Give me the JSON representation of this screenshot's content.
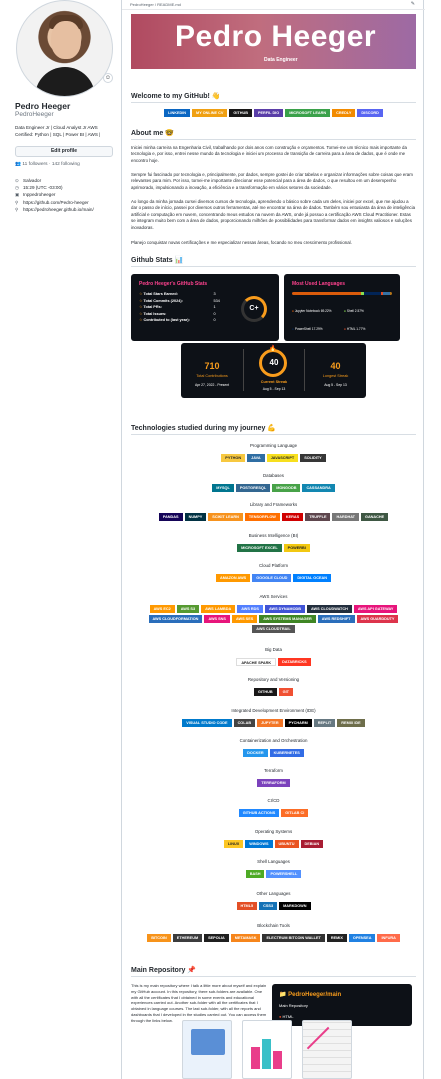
{
  "profile": {
    "name": "Pedro Heeger",
    "username": "PedroHeeger",
    "bio": "Data Engineer Jr | Cloud Analyst Jr AWS Certified: Python | SQL | Power BI | AWS |",
    "edit_label": "Edit profile",
    "followers": "11 followers · 142 following",
    "location": "Salvador",
    "time": "15:29 (UTC -03:00)",
    "email": "Inppedroheeger",
    "links": [
      "https://github.com/Pedro-heeger",
      "https://pedroheeger.github.io/main/"
    ]
  },
  "file": {
    "path": "PedroHeeger / README.md"
  },
  "banner": {
    "title": "Pedro Heeger",
    "subtitle": "Data Engineer"
  },
  "welcome": {
    "title": "Welcome to my GitHub! 👋"
  },
  "social": [
    {
      "label": "LINKEDIN",
      "color": "#0a66c2"
    },
    {
      "label": "MY ONLINE CV",
      "color": "#f0a012"
    },
    {
      "label": "GITHUB",
      "color": "#181717"
    },
    {
      "label": "PERFIL DIO",
      "color": "#5a3ea8"
    },
    {
      "label": "MICROSOFT LEARN",
      "color": "#3aa14a"
    },
    {
      "label": "CREDLY",
      "color": "#f28b00"
    },
    {
      "label": "DISCORD",
      "color": "#5865f2"
    }
  ],
  "about": {
    "title": "About me 🤓",
    "paragraphs": [
      "Iniciei minha carreira na Engenharia Civil, trabalhando por dois anos com construção e orçamentos. Tornei-me um técnico mais importante da tecnologia e, por isso, entrei nesse mundo da tecnologia e iniciei um processo de transição de carreira para a área de dados, que é onde me encontro hoje.",
      "Sempre fui fascinado por tecnologia e, principalmente, por dados, sempre gostei de criar tabelas e organizar informações sobre coisas que eram relevantes para mim. Por isso, tornei-me importante direcionar esse potencial para a área de dados, o que resultou em um desempenho aprimorado, impulsionando a inovação, a eficiência e a transformação em vários setores da sociedade.",
      "Ao longo da minha jornada cursei diversos cursos de tecnologia, aprendendo o básico sobre cada um deles, iniciei por excel, que me ajudou a dar o passo de início, passei por diversos outros ferramentas, até me encontrar na área de dados. Também sou entusiasta da área de inteligência artificial e computação em nuvem, concentrando meus estudos na nuvem da AWS, onde já possuo a certificação AWS Cloud Practitioner. Estas se integram muito bem com a área de dados, proporcionando milhões de possibilidades para transformar dados em insights valiosos e soluções inovadoras.",
      "Planejo conquistar novas certificações e me especializar nessas áreas, focando no meu crescimento profissional."
    ]
  },
  "stats": {
    "title": "Github Stats 📊",
    "card_title": "Pedro Heeger's GitHub Stats",
    "rows": [
      {
        "label": "Total Stars Earned:",
        "value": "3"
      },
      {
        "label": "Total Commits (2024):",
        "value": "534"
      },
      {
        "label": "Total PRs:",
        "value": "1"
      },
      {
        "label": "Total Issues:",
        "value": "0"
      },
      {
        "label": "Contributed to (last year):",
        "value": "0"
      }
    ],
    "grade": "C+",
    "languages_title": "Most Used Languages",
    "languages": [
      {
        "name": "Jupyter Notebook",
        "pct": "69.22%",
        "color": "#DA5B0B"
      },
      {
        "name": "Shell",
        "pct": "2.57%",
        "color": "#89e051"
      },
      {
        "name": "PowerShell",
        "pct": "17.29%",
        "color": "#012456"
      },
      {
        "name": "HTML",
        "pct": "1.77%",
        "color": "#e34c26"
      },
      {
        "name": "Python",
        "pct": "7.29%",
        "color": "#3572A5"
      },
      {
        "name": "JavaScript",
        "pct": "0.09%",
        "color": "#f1e05a"
      },
      {
        "name": "Java",
        "pct": "1.63%",
        "color": "#b07219"
      },
      {
        "name": "Solidity",
        "pct": "0.03%",
        "color": "#AA6746"
      }
    ],
    "streak": {
      "total": "710",
      "total_label": "Total Contributions",
      "total_range": "Apr 27, 2022 - Present",
      "current": "40",
      "current_label": "Current Streak",
      "current_range": "Aug 5 - Sep 13",
      "longest": "40",
      "longest_label": "Longest Streak",
      "longest_range": "Aug 5 - Sep 13"
    }
  },
  "tech": {
    "title": "Technologies studied during my journey 💪",
    "groups": [
      {
        "name": "Programming Language",
        "items": [
          {
            "label": "PYTHON",
            "color": "#f7c840",
            "dark": true
          },
          {
            "label": "JAVA",
            "color": "#2f6ea3"
          },
          {
            "label": "JAVASCRIPT",
            "color": "#f7df1e",
            "dark": true
          },
          {
            "label": "SOLIDITY",
            "color": "#363636"
          }
        ]
      },
      {
        "name": "Databases",
        "items": [
          {
            "label": "MYSQL",
            "color": "#00758f"
          },
          {
            "label": "POSTGRESQL",
            "color": "#336791"
          },
          {
            "label": "MONGODB",
            "color": "#47a248"
          },
          {
            "label": "CASSANDRA",
            "color": "#1287b1"
          }
        ]
      },
      {
        "name": "Library and Frameworks",
        "items": [
          {
            "label": "PANDAS",
            "color": "#150458"
          },
          {
            "label": "NUMPY",
            "color": "#013243"
          },
          {
            "label": "SCIKIT LEARN",
            "color": "#f7931e"
          },
          {
            "label": "TENSORFLOW",
            "color": "#ff6f00"
          },
          {
            "label": "KERAS",
            "color": "#d00000"
          },
          {
            "label": "TRUFFLE",
            "color": "#5e464d"
          },
          {
            "label": "HARDHAT",
            "color": "#777777"
          },
          {
            "label": "GANACHE",
            "color": "#3e5743"
          }
        ]
      },
      {
        "name": "Business Intelligence (BI)",
        "items": [
          {
            "label": "MICROSOFT EXCEL",
            "color": "#217346"
          },
          {
            "label": "POWERBI",
            "color": "#f2c811",
            "dark": true
          }
        ]
      },
      {
        "name": "Cloud Platform",
        "items": [
          {
            "label": "AMAZON AWS",
            "color": "#ff9900"
          },
          {
            "label": "GOOGLE CLOUD",
            "color": "#4285f4"
          },
          {
            "label": "DIGITAL OCEAN",
            "color": "#0080ff"
          }
        ]
      },
      {
        "name": "AWS Services",
        "items": [
          {
            "label": "AWS EC2",
            "color": "#ff9900"
          },
          {
            "label": "AWS S3",
            "color": "#569a31"
          },
          {
            "label": "AWS LAMBDA",
            "color": "#ff9900"
          },
          {
            "label": "AWS RDS",
            "color": "#527fff"
          },
          {
            "label": "AWS DYNAMODB",
            "color": "#4053d6"
          },
          {
            "label": "AWS CLOUDWATCH",
            "color": "#232f3e"
          },
          {
            "label": "AWS API GATEWAY",
            "color": "#e7157b"
          },
          {
            "label": "AWS CLOUDFORMATION",
            "color": "#2a6ebb"
          },
          {
            "label": "AWS SNS",
            "color": "#e7157b"
          },
          {
            "label": "AWS SES",
            "color": "#ff9900"
          },
          {
            "label": "AWS SYSTEMS MANAGER",
            "color": "#3f8624"
          },
          {
            "label": "AWS REDSHIFT",
            "color": "#2a6ebb"
          },
          {
            "label": "AWS GUARDDUTY",
            "color": "#dd344c"
          },
          {
            "label": "AWS CLOUDTRAIL",
            "color": "#555555"
          }
        ]
      },
      {
        "name": "Big Data",
        "items": [
          {
            "label": "APACHE SPARK",
            "color": "#ffffff",
            "dark": true
          },
          {
            "label": "DATABRICKS",
            "color": "#ff3621"
          }
        ]
      },
      {
        "name": "Repository and Versioning",
        "items": [
          {
            "label": "GITHUB",
            "color": "#181717"
          },
          {
            "label": "GIT",
            "color": "#f05032"
          }
        ]
      },
      {
        "name": "Integrated Development Environment (IDE)",
        "items": [
          {
            "label": "VISUAL STUDIO CODE",
            "color": "#007acc"
          },
          {
            "label": "COLAB",
            "color": "#444444"
          },
          {
            "label": "JUPYTER",
            "color": "#f37626"
          },
          {
            "label": "PYCHARM",
            "color": "#000000"
          },
          {
            "label": "REPLIT",
            "color": "#667881"
          },
          {
            "label": "REMIX IDE",
            "color": "#6e6e4b"
          }
        ]
      },
      {
        "name": "Containerization and Orchestration",
        "items": [
          {
            "label": "DOCKER",
            "color": "#2496ed"
          },
          {
            "label": "KUBERNETES",
            "color": "#326ce5"
          }
        ]
      },
      {
        "name": "Terraform",
        "items": [
          {
            "label": "TERRAFORM",
            "color": "#7b42bc"
          }
        ]
      },
      {
        "name": "CI/CD",
        "items": [
          {
            "label": "GITHUB ACTIONS",
            "color": "#2088ff"
          },
          {
            "label": "GITLAB CI",
            "color": "#fc6d26"
          }
        ]
      },
      {
        "name": "Operating Systems",
        "items": [
          {
            "label": "LINUX",
            "color": "#fcc624",
            "dark": true
          },
          {
            "label": "WINDOWS",
            "color": "#0078d6"
          },
          {
            "label": "UBUNTU",
            "color": "#e95420"
          },
          {
            "label": "DEBIAN",
            "color": "#a81d33"
          }
        ]
      },
      {
        "name": "Shell Languages",
        "items": [
          {
            "label": "BASH",
            "color": "#4eaa25"
          },
          {
            "label": "POWERSHELL",
            "color": "#5391fe"
          }
        ]
      },
      {
        "name": "Other Languages",
        "items": [
          {
            "label": "HTML5",
            "color": "#e34f26"
          },
          {
            "label": "CSS3",
            "color": "#1572b6"
          },
          {
            "label": "MARKDOWN",
            "color": "#000000"
          }
        ]
      },
      {
        "name": "Blockchain Tools",
        "items": [
          {
            "label": "BITCOIN",
            "color": "#f7931a"
          },
          {
            "label": "ETHEREUM",
            "color": "#3c3c3d"
          },
          {
            "label": "SEPOLIA",
            "color": "#1f1f1f"
          },
          {
            "label": "METAMASK",
            "color": "#f6851b"
          },
          {
            "label": "ELECTRUM BITCOIN WALLET",
            "color": "#333333"
          },
          {
            "label": "REMIX",
            "color": "#222222"
          },
          {
            "label": "OPENSEA",
            "color": "#2081e2"
          },
          {
            "label": "INFURA",
            "color": "#ff6b4a"
          }
        ]
      }
    ]
  },
  "repo": {
    "title": "Main Repository 📌",
    "text": "This is my main repository where I talk a little more about myself and explain my GitHub account. In this repository, there sub-folders are available. One with all the certificates that I obtained in some events and educational experiences carried out. Another sub-folder with all the certificates that I obtained in language courses. The last sub-folder, with all the reports and dashboards that I developed in the studies carried out. You can access them through the links below.",
    "card_title": "PedroHeeger/main",
    "card_desc": "Main Repository",
    "card_lang": "HTML"
  },
  "colors": {
    "accent": "#fe428e",
    "orange": "#f89c1c",
    "text": "#24292f"
  }
}
